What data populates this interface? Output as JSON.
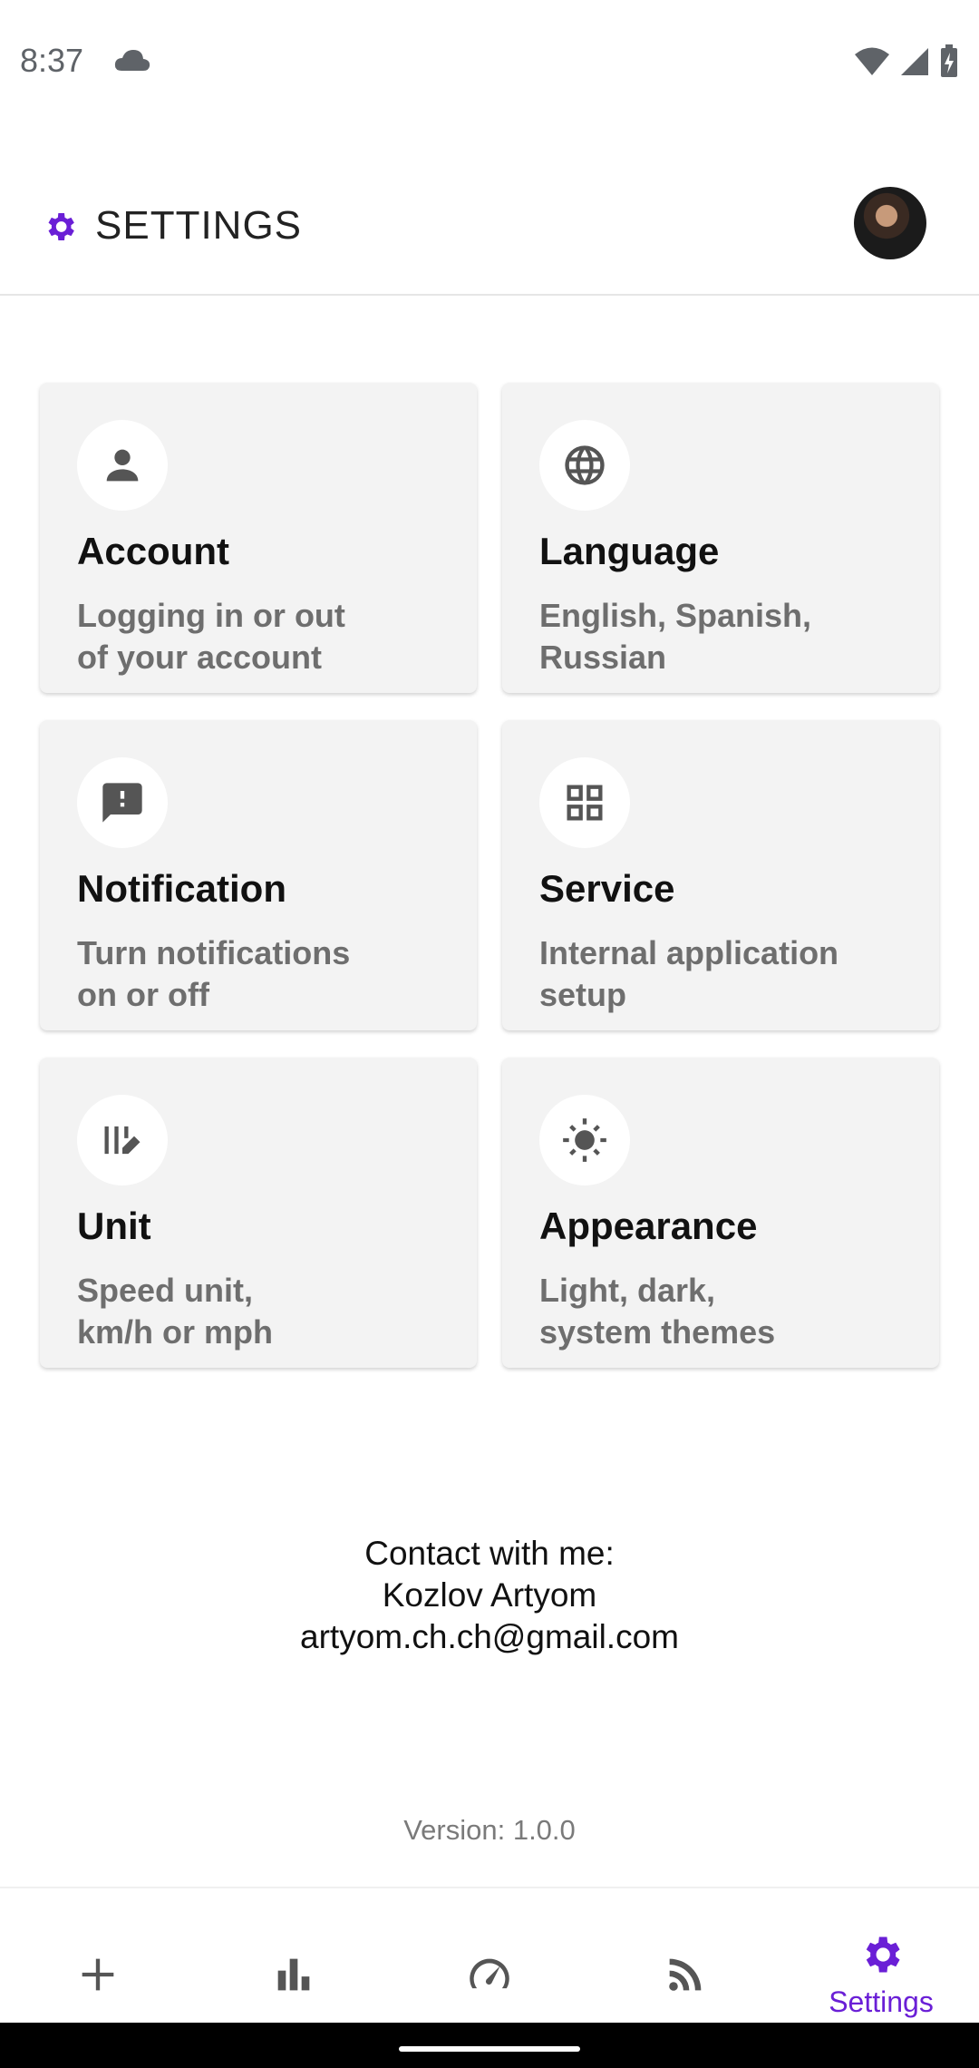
{
  "status_bar": {
    "time": "8:37"
  },
  "header": {
    "title": "SETTINGS"
  },
  "cards": [
    {
      "title": "Account",
      "description": "Logging in or out\nof your account",
      "icon": "person-icon"
    },
    {
      "title": "Language",
      "description": "English, Spanish,\nRussian",
      "icon": "globe-icon"
    },
    {
      "title": "Notification",
      "description": "Turn notifications\non or off",
      "icon": "alert-icon"
    },
    {
      "title": "Service",
      "description": "Internal application\nsetup",
      "icon": "grid-icon"
    },
    {
      "title": "Unit",
      "description": "Speed unit,\nkm/h or mph",
      "icon": "unit-edit-icon"
    },
    {
      "title": "Appearance",
      "description": "Light, dark,\nsystem themes",
      "icon": "sun-icon"
    }
  ],
  "contact": {
    "line1": "Contact with me:",
    "line2": "Kozlov Artyom",
    "line3": "artyom.ch.ch@gmail.com"
  },
  "version": "Version: 1.0.0",
  "bottom_nav": {
    "items": [
      {
        "icon": "plus-icon"
      },
      {
        "icon": "bar-chart-icon"
      },
      {
        "icon": "speedometer-icon"
      },
      {
        "icon": "rss-icon"
      },
      {
        "icon": "gear-icon",
        "label": "Settings",
        "active": true
      }
    ]
  },
  "colors": {
    "accent": "#6a1fd6",
    "card_bg": "#f3f3f3",
    "secondary_text": "#6e6e6e"
  }
}
